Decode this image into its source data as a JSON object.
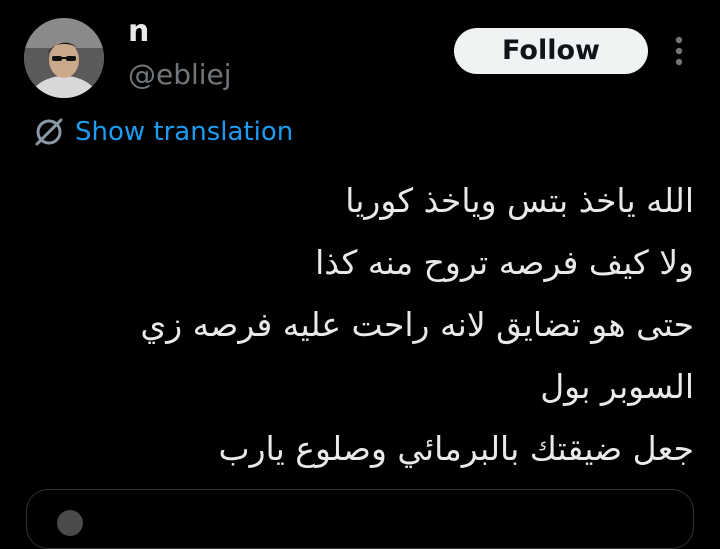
{
  "user": {
    "display_name": "n",
    "handle": "@ebliej",
    "avatar_icon": "profile-photo"
  },
  "actions": {
    "follow_label": "Follow",
    "more_icon": "more-vertical-icon"
  },
  "translation": {
    "label": "Show translation",
    "icon": "globe-icon",
    "color": "#1d9bf0"
  },
  "tweet": {
    "lines": [
      "الله ياخذ بتس وياخذ كوريا",
      "ولا كيف فرصه تروح منه كذا",
      "حتى هو تضايق لانه راحت عليه فرصه زي",
      "السوبر بول",
      "جعل ضيقتك بالبرمائي وصلوع يارب"
    ]
  },
  "colors": {
    "background": "#000000",
    "text_primary": "#e7e9ea",
    "text_secondary": "#71767b",
    "follow_bg": "#eff3f4",
    "accent": "#1d9bf0"
  }
}
